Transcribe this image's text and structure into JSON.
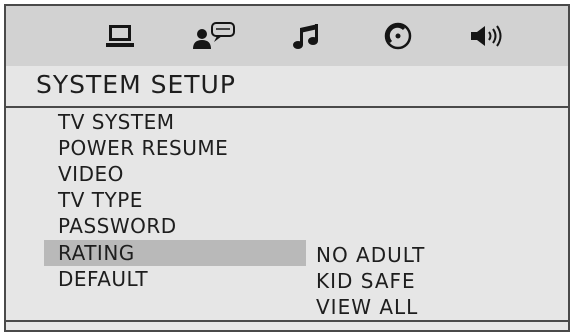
{
  "tabs": [
    {
      "icon": "monitor-icon"
    },
    {
      "icon": "person-speech-icon"
    },
    {
      "icon": "music-note-icon"
    },
    {
      "icon": "disc-icon"
    },
    {
      "icon": "speaker-icon"
    }
  ],
  "header": {
    "title": "SYSTEM SETUP"
  },
  "menu": {
    "items": [
      {
        "label": "TV SYSTEM"
      },
      {
        "label": "POWER RESUME"
      },
      {
        "label": "VIDEO"
      },
      {
        "label": "TV TYPE"
      },
      {
        "label": "PASSWORD"
      },
      {
        "label": "RATING"
      },
      {
        "label": "DEFAULT"
      }
    ],
    "selected": "RATING"
  },
  "options": {
    "items": [
      {
        "label": "NO ADULT"
      },
      {
        "label": "KID SAFE"
      },
      {
        "label": "VIEW ALL"
      }
    ]
  }
}
